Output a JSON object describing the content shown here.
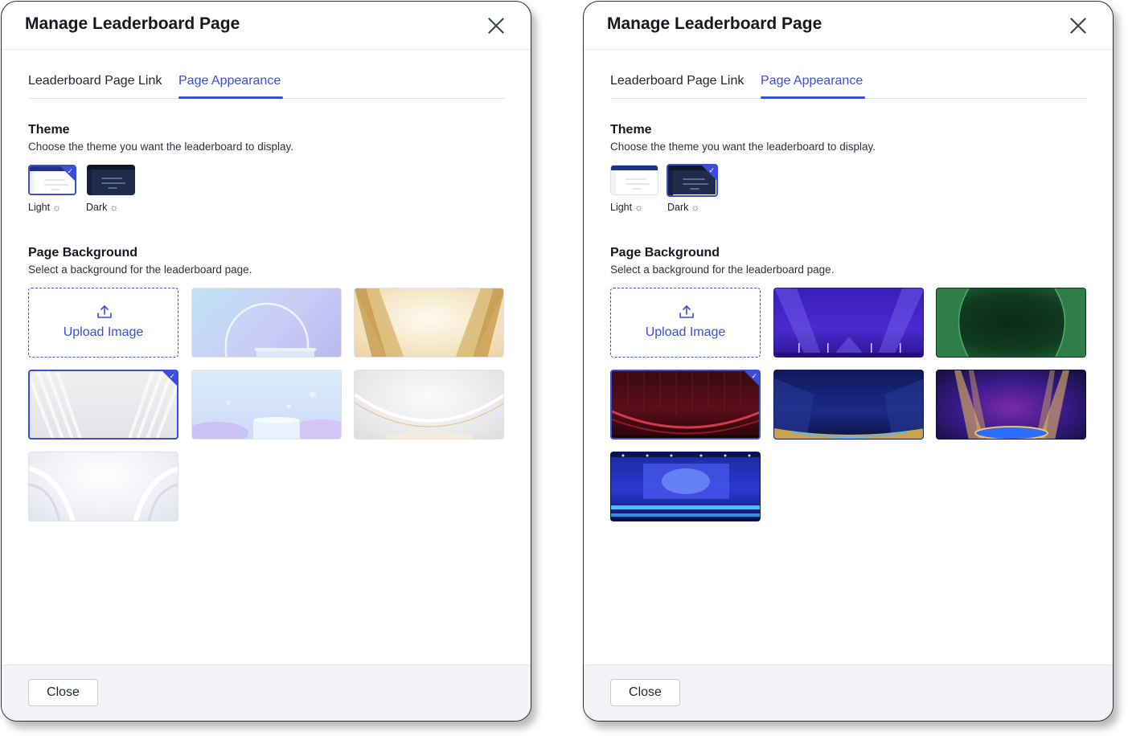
{
  "panels": [
    {
      "title": "Manage Leaderboard Page",
      "tabs": [
        "Leaderboard Page Link",
        "Page Appearance"
      ],
      "active_tab": "Page Appearance",
      "theme_title": "Theme",
      "theme_desc": "Choose the theme you want the leaderboard to display.",
      "themes": [
        {
          "label": "Light",
          "selected": true
        },
        {
          "label": "Dark",
          "selected": false
        }
      ],
      "bg_title": "Page Background",
      "bg_desc": "Select a background for the leaderboard page.",
      "upload_label": "Upload Image",
      "backgrounds": [
        "light-arch-glow",
        "gold-fans",
        "white-stripes",
        "pastel-bubbles-podium",
        "silver-ribbon-stage",
        "white-curves"
      ],
      "selected_background": "white-stripes",
      "close_label": "Close"
    },
    {
      "title": "Manage Leaderboard Page",
      "tabs": [
        "Leaderboard Page Link",
        "Page Appearance"
      ],
      "active_tab": "Page Appearance",
      "theme_title": "Theme",
      "theme_desc": "Choose the theme you want the leaderboard to display.",
      "themes": [
        {
          "label": "Light",
          "selected": false
        },
        {
          "label": "Dark",
          "selected": true
        }
      ],
      "bg_title": "Page Background",
      "bg_desc": "Select a background for the leaderboard page.",
      "upload_label": "Upload Image",
      "backgrounds": [
        "purple-spotlights",
        "green-curtain",
        "red-stage-curtain",
        "navy-gold-stage",
        "purple-gold-spotlights",
        "blue-concert-stage"
      ],
      "selected_background": "red-stage-curtain",
      "close_label": "Close"
    }
  ],
  "colors": {
    "accent": "#3a4ed8",
    "dark_theme": "#1e2b4d",
    "footer_bg": "#f3f4f7"
  }
}
